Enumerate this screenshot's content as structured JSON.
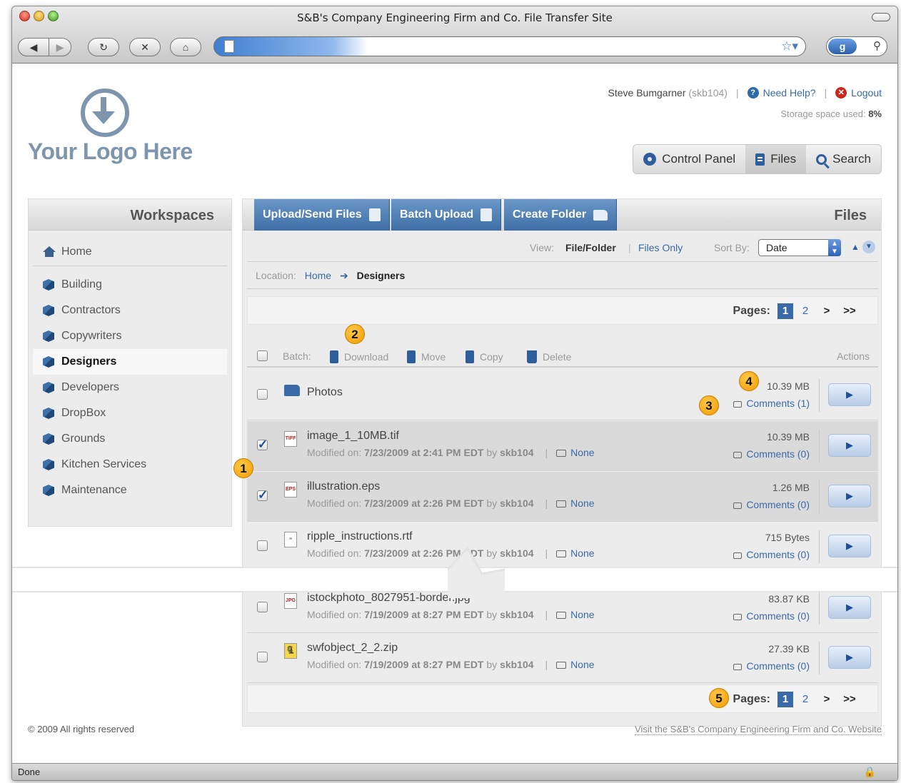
{
  "window": {
    "title": "S&B's Company Engineering Firm and Co. File Transfer Site",
    "status": "Done"
  },
  "logo": {
    "text": "Your Logo Here"
  },
  "user": {
    "name": "Steve Bumgarner",
    "username": "(skb104)",
    "help_label": "Need Help?",
    "logout_label": "Logout",
    "storage_label": "Storage space used:",
    "storage_value": "8%"
  },
  "topnav": {
    "control_panel": "Control Panel",
    "files": "Files",
    "search": "Search"
  },
  "sidebar": {
    "title": "Workspaces",
    "home": "Home",
    "items": [
      "Building",
      "Contractors",
      "Copywriters",
      "Designers",
      "Developers",
      "DropBox",
      "Grounds",
      "Kitchen Services",
      "Maintenance"
    ],
    "active": "Designers"
  },
  "main": {
    "title": "Files",
    "upload_label": "Upload/Send Files",
    "batch_upload_label": "Batch Upload",
    "create_folder_label": "Create Folder",
    "view_label": "View:",
    "view_filefolder": "File/Folder",
    "view_filesonly": "Files Only",
    "sort_label": "Sort By:",
    "sort_value": "Date",
    "location_label": "Location:",
    "location_home": "Home",
    "location_current": "Designers",
    "pages_label": "Pages:",
    "pages": [
      "1",
      "2"
    ],
    "page_next": ">",
    "page_last": ">>",
    "batch_label": "Batch:",
    "batch_download": "Download",
    "batch_move": "Move",
    "batch_copy": "Copy",
    "batch_delete": "Delete",
    "actions_header": "Actions"
  },
  "files": [
    {
      "type": "folder",
      "badge": "",
      "name": "Photos",
      "size": "10.39 MB",
      "comments": "Comments (1)",
      "checked": false
    },
    {
      "type": "file",
      "badge": "TIFF",
      "name": "image_1_10MB.tif",
      "modified_label": "Modified on:",
      "modified": "7/23/2009 at 2:41 PM EDT",
      "by_label": "by",
      "by": "skb104",
      "tag": "None",
      "size": "10.39 MB",
      "comments": "Comments (0)",
      "checked": true
    },
    {
      "type": "file",
      "badge": "EPS",
      "name": "illustration.eps",
      "modified_label": "Modified on:",
      "modified": "7/23/2009 at 2:26 PM EDT",
      "by_label": "by",
      "by": "skb104",
      "tag": "None",
      "size": "1.26 MB",
      "comments": "Comments (0)",
      "checked": true
    },
    {
      "type": "file",
      "badge": "",
      "name": "ripple_instructions.rtf",
      "modified_label": "Modified on:",
      "modified": "7/23/2009 at 2:26 PM EDT",
      "by_label": "by",
      "by": "skb104",
      "tag": "None",
      "size": "715 Bytes",
      "comments": "Comments (0)",
      "checked": false
    },
    {
      "type": "file",
      "badge": "JPG",
      "name": "istockphoto_8027951-border.jpg",
      "modified_label": "Modified on:",
      "modified": "7/19/2009 at 8:27 PM EDT",
      "by_label": "by",
      "by": "skb104",
      "tag": "None",
      "size": "83.87 KB",
      "comments": "Comments (0)",
      "checked": false
    },
    {
      "type": "file",
      "badge": "",
      "name": "swfobject_2_2.zip",
      "modified_label": "Modified on:",
      "modified": "7/19/2009 at 8:27 PM EDT",
      "by_label": "by",
      "by": "skb104",
      "tag": "None",
      "size": "27.39 KB",
      "comments": "Comments (0)",
      "checked": false
    }
  ],
  "callouts": [
    "1",
    "2",
    "3",
    "4",
    "5"
  ],
  "footer": {
    "copyright": "© 2009 All rights reserved",
    "site_link": "Visit the S&B's Company Engineering Firm and Co. Website"
  },
  "colors": {
    "accent": "#3a6aa8",
    "callout": "#f29a00",
    "selected_row": "#dadada"
  }
}
